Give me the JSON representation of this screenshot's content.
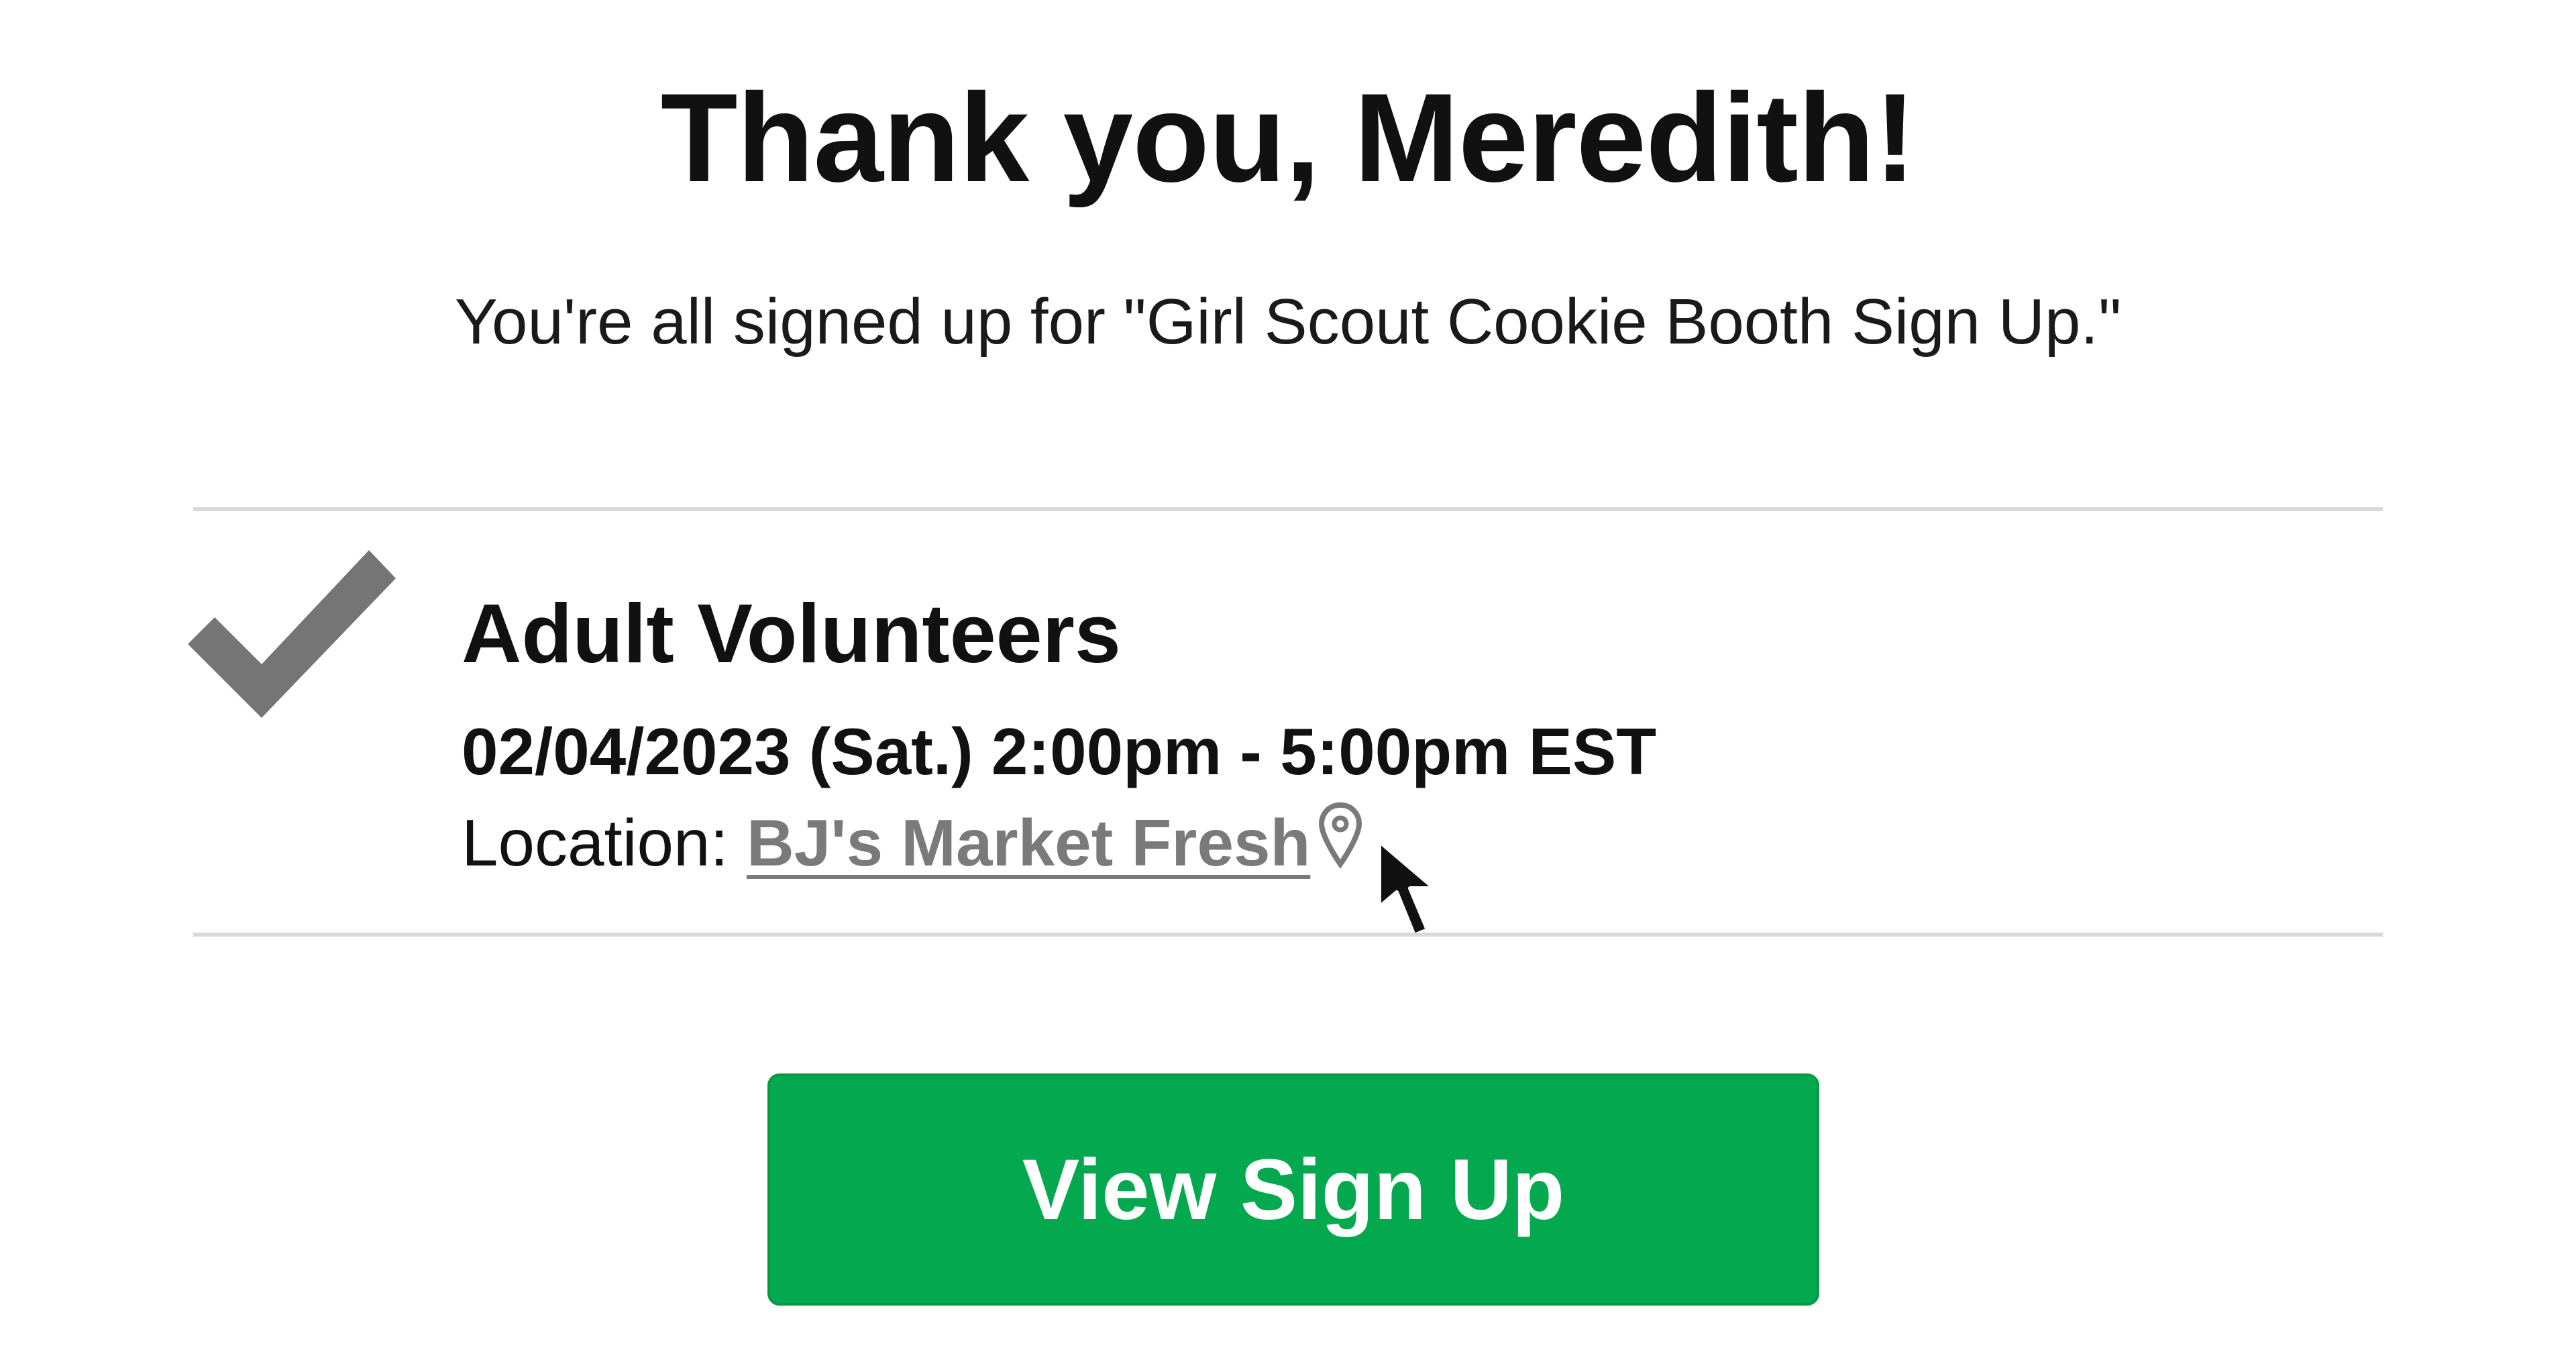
{
  "header": {
    "title": "Thank you, Meredith!",
    "subtitle": "You're all signed up for \"Girl Scout Cookie Booth Sign Up.\""
  },
  "slot": {
    "status_icon": "checkmark-icon",
    "title": "Adult Volunteers",
    "datetime": "02/04/2023 (Sat.) 2:00pm - 5:00pm EST",
    "location_label": "Location:",
    "location_name": "BJ's Market Fresh ",
    "location_icon": "map-pin-icon"
  },
  "actions": {
    "view_signup_label": "View Sign Up"
  },
  "colors": {
    "accent_green": "#04a94f",
    "check_gray": "#757575",
    "link_gray": "#7a7a7a",
    "divider": "#d9d9d9"
  }
}
